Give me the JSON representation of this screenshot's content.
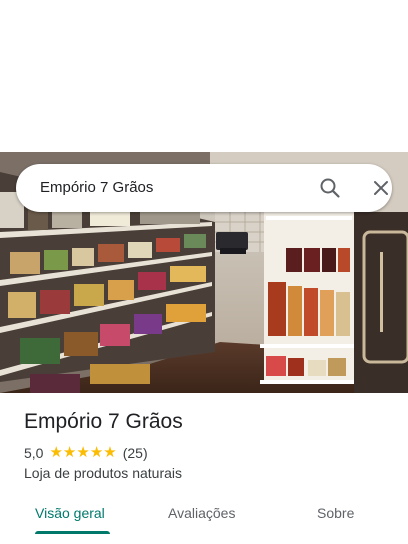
{
  "search": {
    "query": "Empório 7 Grãos"
  },
  "place": {
    "name": "Empório 7 Grãos",
    "rating": "5,0",
    "stars": 5,
    "review_count": "(25)",
    "category": "Loja de produtos naturais"
  },
  "tabs": [
    {
      "label": "Visão geral",
      "active": true
    },
    {
      "label": "Avaliações",
      "active": false
    },
    {
      "label": "Sobre",
      "active": false
    }
  ],
  "colors": {
    "accent": "#00796b",
    "star": "#fbbc04"
  },
  "icons": [
    "search-icon",
    "close-icon",
    "star-icon"
  ]
}
